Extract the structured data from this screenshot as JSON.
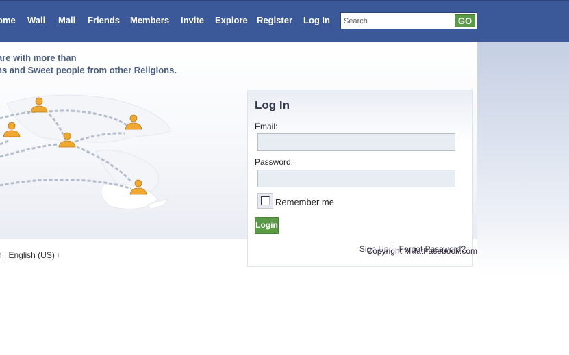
{
  "header": {
    "nav": [
      {
        "label": "Home",
        "visible_text": "ome"
      },
      {
        "label": "Wall"
      },
      {
        "label": "Mail"
      },
      {
        "label": "Friends"
      },
      {
        "label": "Members"
      },
      {
        "label": "Invite"
      },
      {
        "label": "Explore"
      },
      {
        "label": "Register"
      },
      {
        "label": "Log In"
      }
    ],
    "search": {
      "placeholder": "Search",
      "value": "",
      "button_label": "GO"
    }
  },
  "main": {
    "tagline": {
      "line1": "are with more than",
      "line2": "ns and Sweet people from other Religions."
    },
    "map": {
      "icon": "person-icon",
      "description": "world map with connected people"
    }
  },
  "login": {
    "title": "Log In",
    "email_label": "Email:",
    "email_value": "",
    "password_label": "Password:",
    "password_value": "",
    "remember_label": "Remember me",
    "remember_checked": false,
    "button_label": "Login",
    "signup_link": "Sign Up",
    "forgot_link": "Forgot Password?"
  },
  "footer": {
    "left_text": "n | ",
    "language": "English (US)",
    "language_icon": "up-down-arrows",
    "copyright": "Copyright MillatFacebook.com"
  },
  "colors": {
    "header_bg": "#3b5998",
    "accent_green": "#5b9a46",
    "tagline_text": "#4b5e82",
    "person_icon": "#f0a830",
    "dash_line": "#b4bdcc"
  }
}
